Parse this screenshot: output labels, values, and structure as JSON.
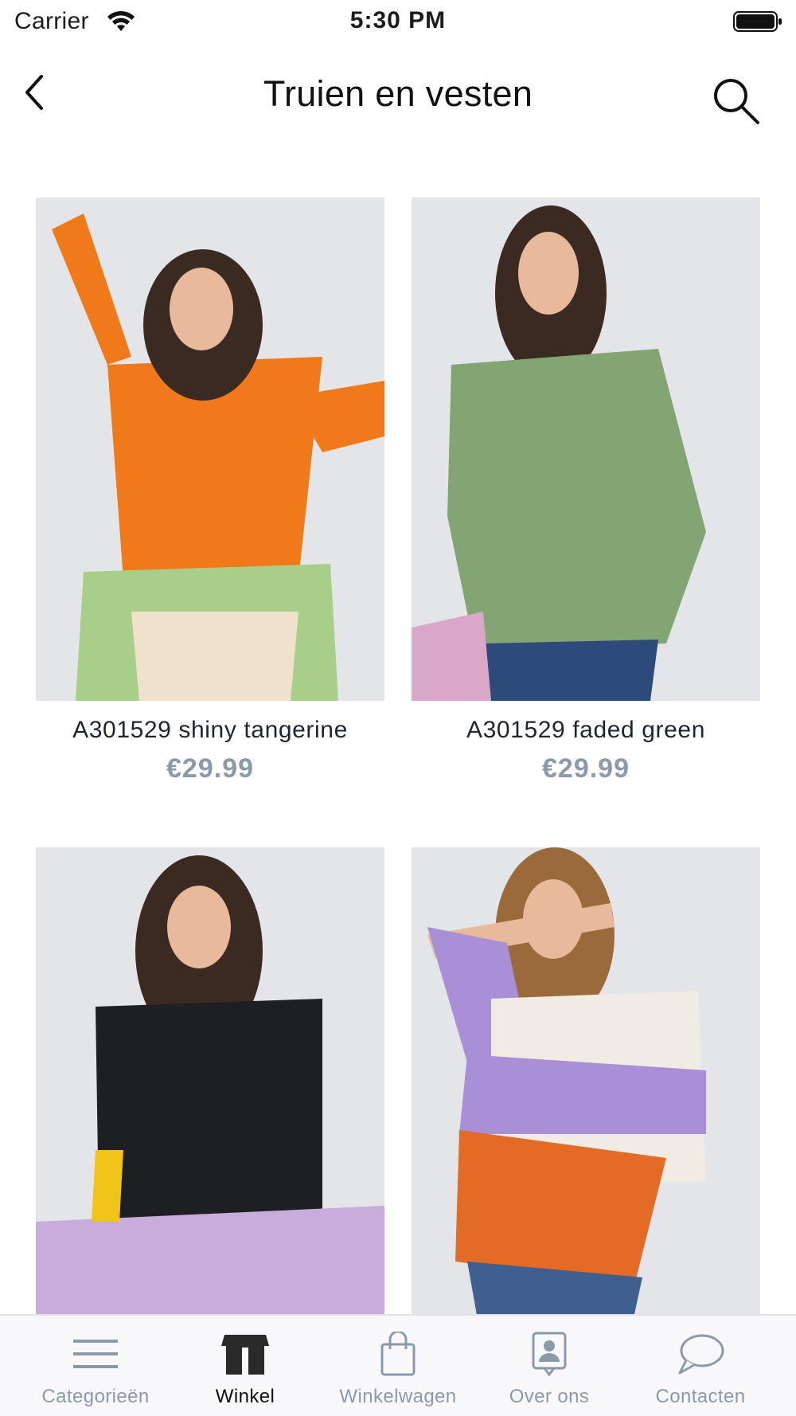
{
  "status_bar": {
    "carrier": "Carrier",
    "time": "5:30 PM",
    "wifi_icon": "wifi-icon",
    "battery_icon": "battery-icon"
  },
  "nav": {
    "title": "Truien en vesten",
    "back_icon": "chevron-left-icon",
    "search_icon": "search-icon"
  },
  "products": [
    {
      "name": "A301529 shiny tangerine",
      "price": "€29.99",
      "sweater_color": "#f07a1a",
      "accent_color": "#a8cf8a"
    },
    {
      "name": "A301529 faded green",
      "price": "€29.99",
      "sweater_color": "#83a573",
      "accent_color": "#2d4b7a"
    },
    {
      "sweater_color": "#1e1f22",
      "accent_color": "#c7acdc"
    },
    {
      "sweater_color": "#a98fd6",
      "accent_color": "#e36b25"
    }
  ],
  "tabs": [
    {
      "label": "Categorieën",
      "icon": "menu-icon",
      "active": false
    },
    {
      "label": "Winkel",
      "icon": "store-icon",
      "active": true
    },
    {
      "label": "Winkelwagen",
      "icon": "shopping-bag-icon",
      "active": false
    },
    {
      "label": "Over ons",
      "icon": "contact-card-icon",
      "active": false
    },
    {
      "label": "Contacten",
      "icon": "chat-bubble-icon",
      "active": false
    }
  ],
  "colors": {
    "price": "#8a9aab",
    "tab_inactive": "#8a9aab",
    "tab_active": "#111111",
    "image_background": "#e3e5e8"
  }
}
